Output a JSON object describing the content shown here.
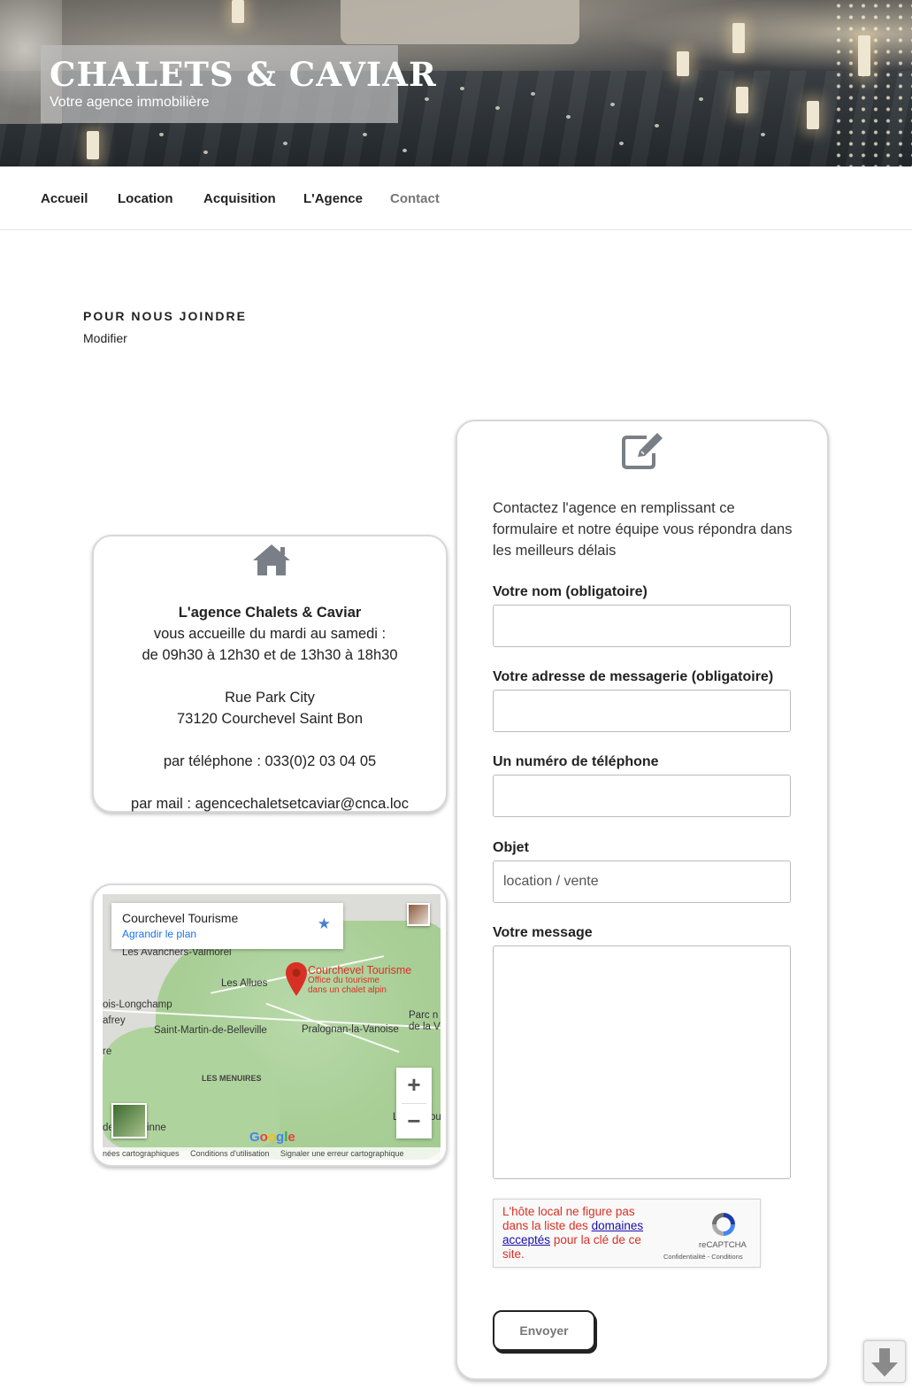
{
  "header": {
    "site_title": "CHALETS & CAVIAR",
    "tagline": "Votre agence immobilière"
  },
  "nav": {
    "items": [
      {
        "label": "Accueil",
        "active": false
      },
      {
        "label": "Location",
        "active": false
      },
      {
        "label": "Acquisition",
        "active": false
      },
      {
        "label": "L'Agence",
        "active": false
      },
      {
        "label": "Contact",
        "active": true
      }
    ]
  },
  "page": {
    "title": "POUR NOUS JOINDRE",
    "edit_link": "Modifier"
  },
  "info_card": {
    "icon": "home-icon",
    "agency_name": "L'agence Chalets & Caviar",
    "welcome": "vous accueille du mardi au samedi :",
    "hours": "de 09h30 à 12h30 et de 13h30 à 18h30",
    "street": "Rue Park City",
    "city": "73120 Courchevel Saint Bon",
    "phone": "par téléphone : 033(0)2 03 04 05",
    "email": "par mail : agencechaletsetcaviar@cnca.loc"
  },
  "map": {
    "place_name": "Courchevel Tourisme",
    "enlarge_link": "Agrandir le plan",
    "pin_title": "Courchevel Tourisme",
    "pin_subtitle_1": "Office du tourisme",
    "pin_subtitle_2": "dans un chalet alpin",
    "labels": {
      "avanchers": "Les Avanchers-Valmorel",
      "allues": "Les Allues",
      "longchamp": "ois-Longchamp",
      "afrey": "afrey",
      "st_martin": "Saint-Martin-de-Belleville",
      "pralognan": "Pralognan-la-Vanoise",
      "parc_1": "Parc n",
      "parc_2": "de la V",
      "menuires": "LES MENUIRES",
      "re": "re",
      "de": "de",
      "inne": "inne",
      "l": "L",
      "ou": "ou"
    },
    "zoom_in": "+",
    "zoom_out": "−",
    "google": "Google",
    "footer_data": "nées cartographiques",
    "footer_terms": "Conditions d'utilisation",
    "footer_report": "Signaler une erreur cartographique",
    "pin_color": "#d93025"
  },
  "form": {
    "icon": "edit-icon",
    "intro": "Contactez l'agence en remplissant ce formulaire et notre équipe vous répondra dans les meilleurs délais",
    "name_label": "Votre nom (obligatoire)",
    "name_value": "",
    "email_label": "Votre adresse de messagerie (obligatoire)",
    "email_value": "",
    "phone_label": "Un numéro de téléphone",
    "phone_value": "",
    "subject_label": "Objet",
    "subject_value": "location / vente",
    "message_label": "Votre message",
    "message_value": "",
    "recaptcha_msg_1": "L'hôte local ne figure pas dans la liste des",
    "recaptcha_link": "domaines acceptés",
    "recaptcha_msg_2": "pour la clé de ce site.",
    "recaptcha_name": "reCAPTCHA",
    "recaptcha_terms": "Confidentialité - Conditions",
    "submit_label": "Envoyer"
  },
  "scroll_button": {
    "icon": "arrow-down-icon"
  }
}
